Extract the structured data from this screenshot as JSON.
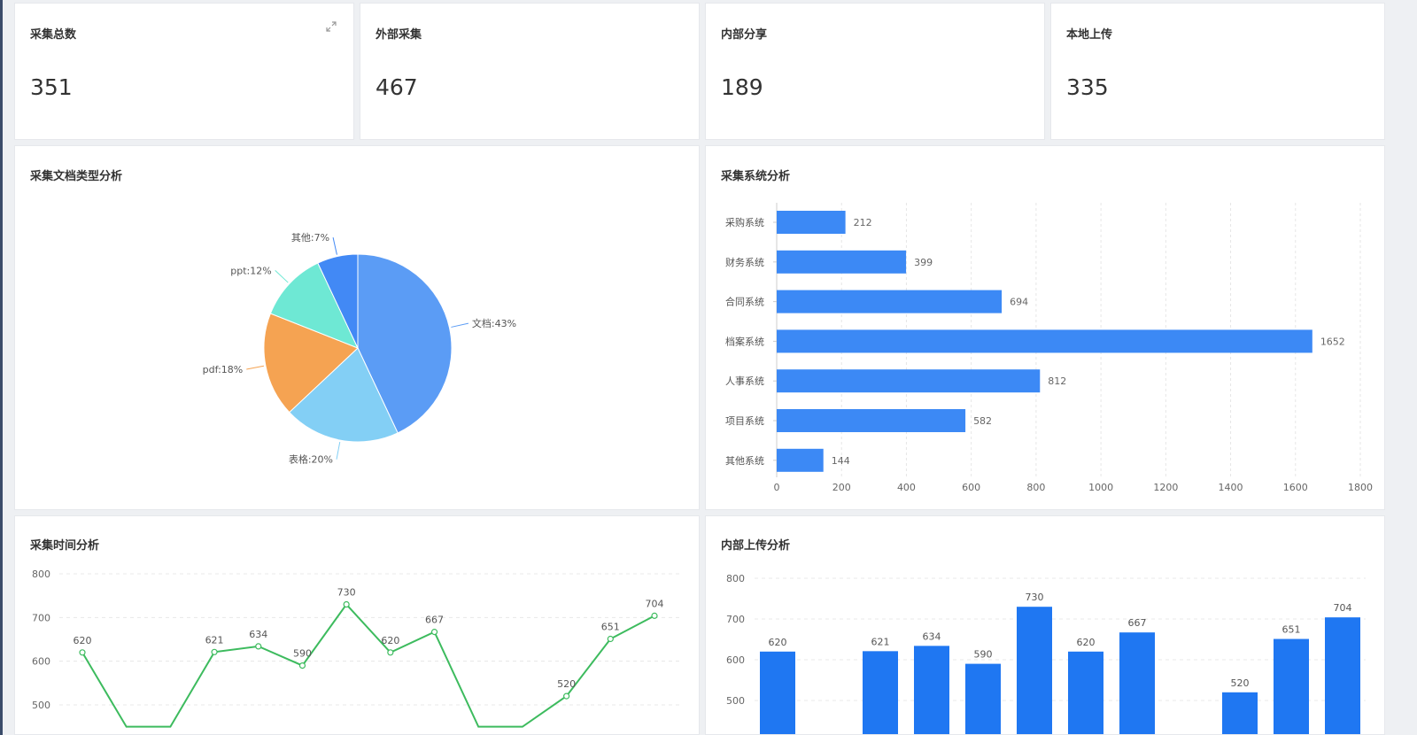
{
  "stats": [
    {
      "title": "采集总数",
      "value": "351"
    },
    {
      "title": "外部采集",
      "value": "467"
    },
    {
      "title": "内部分享",
      "value": "189"
    },
    {
      "title": "本地上传",
      "value": "335"
    }
  ],
  "panels": {
    "pie_title": "采集文档类型分析",
    "system_title": "采集系统分析",
    "time_title": "采集时间分析",
    "upload_title": "内部上传分析"
  },
  "colors": {
    "bar": "#3c89f5",
    "bar_dark": "#1f77f2",
    "line": "#3dbb5e",
    "pie": [
      "#5b9cf5",
      "#83cff5",
      "#f5a352",
      "#6ee8d4",
      "#4289f5"
    ]
  },
  "chart_data": [
    {
      "type": "pie",
      "title": "",
      "slices": [
        {
          "label": "文档:43%",
          "value": 43
        },
        {
          "label": "表格:20%",
          "value": 20
        },
        {
          "label": "pdf:18%",
          "value": 18
        },
        {
          "label": "ppt:12%",
          "value": 12
        },
        {
          "label": "其他:7%",
          "value": 7
        }
      ]
    },
    {
      "type": "bar",
      "orientation": "horizontal",
      "categories": [
        "采购系统",
        "财务系统",
        "合同系统",
        "档案系统",
        "人事系统",
        "项目系统",
        "其他系统"
      ],
      "values": [
        212,
        399,
        694,
        1652,
        812,
        582,
        144
      ],
      "xlim": [
        0,
        1800
      ],
      "xticks": [
        "0",
        "200",
        "400",
        "600",
        "800",
        "1000",
        "1200",
        "1400",
        "1600",
        "1800"
      ],
      "grid": true
    },
    {
      "type": "line",
      "values": [
        620,
        450,
        450,
        621,
        634,
        590,
        730,
        620,
        667,
        450,
        450,
        520,
        651,
        704
      ],
      "labels": [
        "620",
        "",
        "",
        "621",
        "634",
        "590",
        "730",
        "620",
        "667",
        "",
        "",
        "520",
        "651",
        "704"
      ],
      "ylim": [
        500,
        800
      ],
      "yticks": [
        "800",
        "700",
        "600",
        "500"
      ],
      "grid": true
    },
    {
      "type": "bar",
      "values": [
        620,
        0,
        621,
        634,
        590,
        730,
        620,
        667,
        0,
        520,
        651,
        704
      ],
      "labels": [
        "620",
        "",
        "621",
        "634",
        "590",
        "730",
        "620",
        "667",
        "",
        "520",
        "651",
        "704"
      ],
      "ylim": [
        500,
        800
      ],
      "yticks": [
        "800",
        "700",
        "600",
        "500"
      ],
      "grid": true
    }
  ]
}
